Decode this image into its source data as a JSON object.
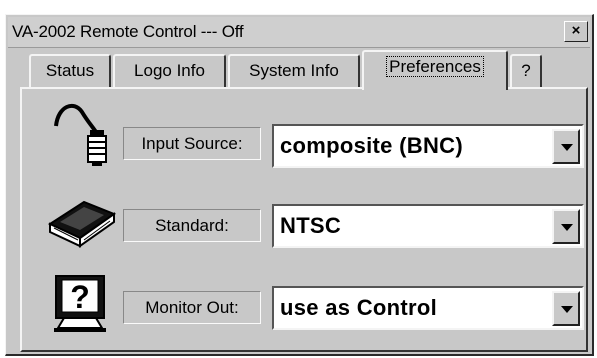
{
  "window": {
    "title": "VA-2002 Remote Control --- Off",
    "close_glyph": "×"
  },
  "tabs": [
    {
      "label": "Status"
    },
    {
      "label": "Logo Info"
    },
    {
      "label": "System Info"
    },
    {
      "label": "Preferences",
      "active": true
    },
    {
      "label": "?"
    }
  ],
  "rows": [
    {
      "icon": "cable-connector-icon",
      "label": "Input Source:",
      "value": "composite (BNC)"
    },
    {
      "icon": "book-icon",
      "label": "Standard:",
      "value": "NTSC"
    },
    {
      "icon": "monitor-question-icon",
      "label": "Monitor Out:",
      "value": "use as Control"
    }
  ]
}
